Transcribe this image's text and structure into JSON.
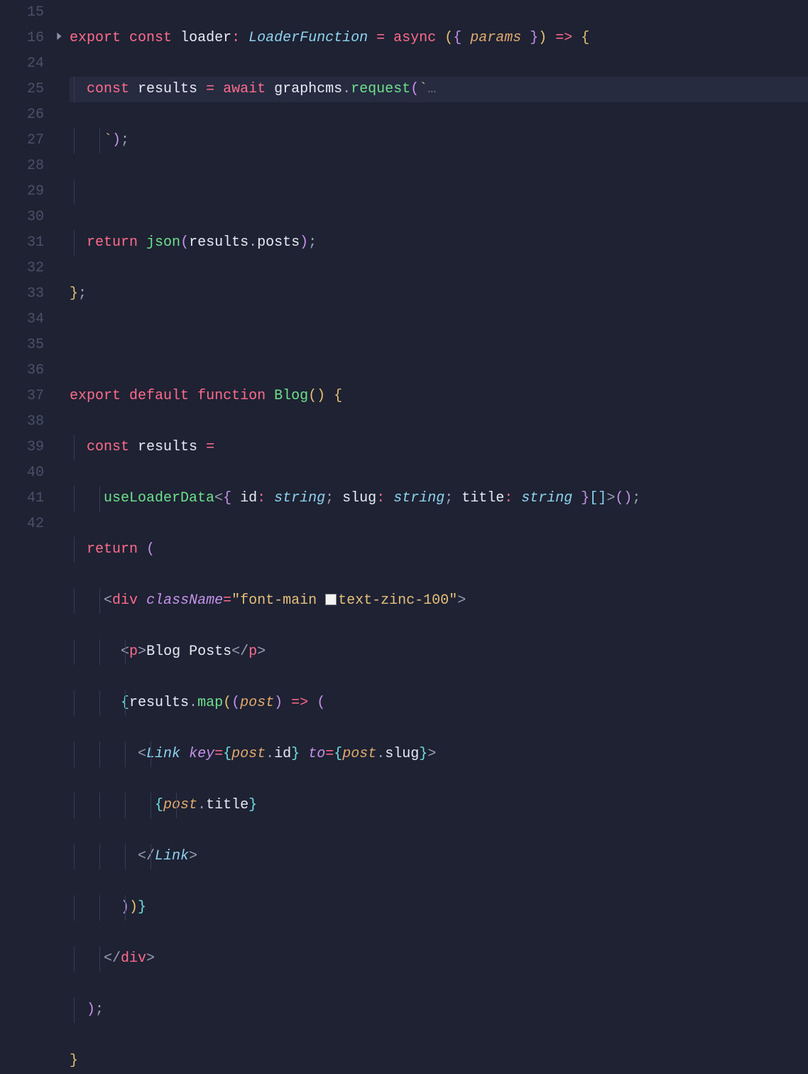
{
  "gutter": {
    "lines": [
      "15",
      "16",
      "24",
      "25",
      "26",
      "27",
      "28",
      "29",
      "30",
      "31",
      "32",
      "33",
      "34",
      "35",
      "36",
      "37",
      "38",
      "39",
      "40",
      "41",
      "42"
    ]
  },
  "fold": {
    "arrowLine": 1
  },
  "code": {
    "l15": {
      "export": "export",
      "const": "const",
      "sp": " ",
      "loader": "loader",
      "colon": ": ",
      "type": "LoaderFunction",
      "eq": " = ",
      "async": "async",
      "sp2": " ",
      "paren_o": "(",
      "brace_o": "{",
      "sp3": " ",
      "params": "params",
      "sp4": " ",
      "brace_c": "}",
      "paren_c": ")",
      "sp5": " ",
      "arrow": "=>",
      "sp6": " ",
      "body_o": "{"
    },
    "l16": {
      "const": "const",
      "sp": " ",
      "results": "results",
      "eq": " = ",
      "await": "await",
      "sp2": " ",
      "obj": "graphcms",
      "dot": ".",
      "method": "request",
      "paren_o": "(",
      "tick": "`",
      "dots": "…"
    },
    "l24": {
      "tick": "`",
      "paren_c": ")",
      "semi": ";"
    },
    "l26": {
      "return": "return",
      "sp": " ",
      "json": "json",
      "paren_o": "(",
      "results": "results",
      "dot": ".",
      "posts": "posts",
      "paren_c": ")",
      "semi": ";"
    },
    "l27": {
      "brace_c": "}",
      "semi": ";"
    },
    "l29": {
      "export": "export",
      "default": "default",
      "function": "function",
      "name": "Blog",
      "paren": "()",
      "sp": " ",
      "brace_o": "{"
    },
    "l30": {
      "const": "const",
      "sp": " ",
      "results": "results",
      "eq": " ="
    },
    "l31": {
      "fn": "useLoaderData",
      "lt": "<",
      "brace_o": "{",
      "sp": " ",
      "id": "id",
      "c1": ": ",
      "string1": "string",
      "semi1": "; ",
      "slug": "slug",
      "c2": ": ",
      "string2": "string",
      "semi2": "; ",
      "title": "title",
      "c3": ": ",
      "string3": "string",
      "sp2": " ",
      "brace_c": "}",
      "arr": "[]",
      "gt": ">",
      "call": "()",
      "semi": ";"
    },
    "l32": {
      "return": "return",
      "sp": " ",
      "paren_o": "("
    },
    "l33": {
      "lt": "<",
      "div": "div",
      "sp": " ",
      "className": "className",
      "eq": "=",
      "q1": "\"",
      "cls1": "font-main ",
      "cls2": "text-zinc-100",
      "q2": "\"",
      "gt": ">"
    },
    "l34": {
      "lt": "<",
      "p": "p",
      "gt": ">",
      "text": "Blog Posts",
      "lt2": "</",
      "p2": "p",
      "gt2": ">"
    },
    "l35": {
      "bo": "{",
      "results": "results",
      "dot": ".",
      "map": "map",
      "po": "(",
      "po2": "(",
      "post": "post",
      "pc2": ")",
      "sp": " ",
      "arrow": "=>",
      "sp2": " ",
      "po3": "("
    },
    "l36": {
      "lt": "<",
      "Link": "Link",
      "sp": " ",
      "key": "key",
      "eq": "=",
      "bo": "{",
      "post": "post",
      "dot": ".",
      "id": "id",
      "bc": "}",
      "sp2": " ",
      "to": "to",
      "eq2": "=",
      "bo2": "{",
      "post2": "post",
      "dot2": ".",
      "slug": "slug",
      "bc2": "}",
      "gt": ">"
    },
    "l37": {
      "bo": "{",
      "post": "post",
      "dot": ".",
      "title": "title",
      "bc": "}"
    },
    "l38": {
      "lt": "</",
      "Link": "Link",
      "gt": ">"
    },
    "l39": {
      "pc": ")",
      "pc2": ")",
      "bc": "}"
    },
    "l40": {
      "lt": "</",
      "div": "div",
      "gt": ">"
    },
    "l41": {
      "pc": ")",
      "semi": ";"
    },
    "l42": {
      "bc": "}"
    }
  }
}
